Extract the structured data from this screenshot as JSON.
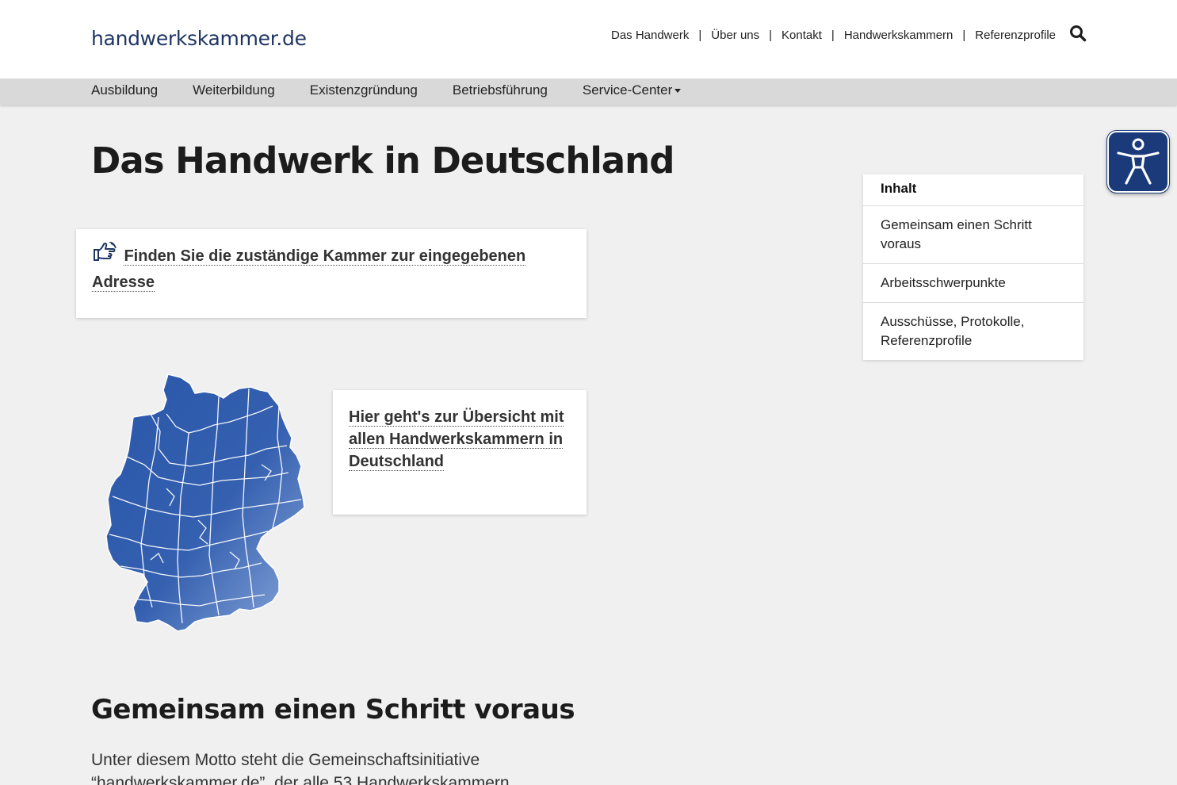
{
  "header": {
    "logo_text": "handwerkskammer.de",
    "top_links": [
      "Das Handwerk",
      "Über uns",
      "Kontakt",
      "Handwerkskammern",
      "Referenzprofile"
    ],
    "separator": "|",
    "search_icon": "search-icon"
  },
  "main_nav": {
    "items": [
      "Ausbildung",
      "Weiterbildung",
      "Existenzgründung",
      "Betriebsführung",
      "Service-Center"
    ]
  },
  "page": {
    "title": "Das Handwerk in Deutschland",
    "finder_link": "Finden Sie die zuständige Kammer zur eingegebenen Adresse",
    "overview_link": "Hier geht's zur Übersicht mit allen Handwerkskammern in Deutschland",
    "section_title": "Gemeinsam einen Schritt voraus",
    "section_text": "Unter diesem Motto steht die Gemeinschaftsinitiative “handwerkskammer.de”, der alle 53 Handwerkskammern"
  },
  "toc": {
    "heading": "Inhalt",
    "items": [
      "Gemeinsam einen Schritt voraus",
      "Arbeitsschwerpunkte",
      "Ausschüsse, Protokolle, Referenzprofile"
    ]
  },
  "colors": {
    "brand": "#1f3563",
    "map_blue": "#2f5cad",
    "accessibility_button": "#1a3a7a"
  }
}
